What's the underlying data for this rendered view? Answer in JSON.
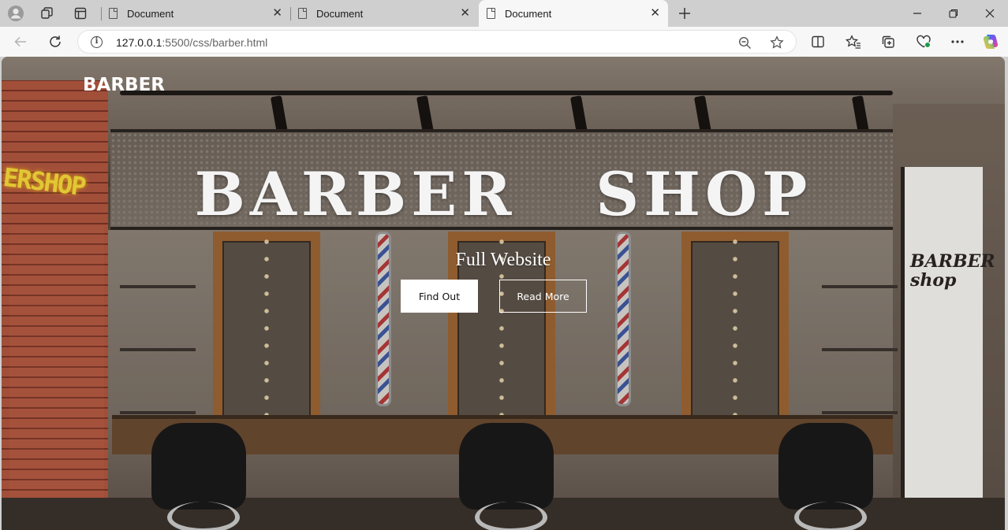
{
  "browser": {
    "tabs": [
      {
        "title": "Document",
        "active": false
      },
      {
        "title": "Document",
        "active": false
      },
      {
        "title": "Document",
        "active": true
      }
    ],
    "address": {
      "host": "127.0.0.1",
      "path": ":5500/css/barber.html"
    },
    "icons": {
      "profile": "profile-icon",
      "workspaces": "workspaces-icon",
      "tab_actions": "tab-actions-icon",
      "new_tab": "plus-icon",
      "back": "back-arrow-icon",
      "reload": "reload-icon",
      "info": "site-info-icon",
      "zoom": "zoom-out-icon",
      "favorite": "star-icon",
      "split": "split-screen-icon",
      "favorites": "favorites-icon",
      "collections": "collections-icon",
      "extensions": "browser-essentials-icon",
      "menu": "more-menu-icon",
      "copilot": "copilot-icon"
    }
  },
  "page": {
    "logo": "BARBER",
    "hero_title": "BARBER  SHOP",
    "hero_subtitle": "Full Website",
    "buttons": {
      "find_out": "Find Out",
      "read_more": "Read More"
    },
    "background_signs": {
      "neon": "ERSHOP",
      "wall_sign": "BARBER shop"
    }
  },
  "colors": {
    "text_white": "#ffffff",
    "neon_yellow": "#f5d83a",
    "tabstrip": "#cfcfcf",
    "toolbar": "#f7f7f7"
  }
}
